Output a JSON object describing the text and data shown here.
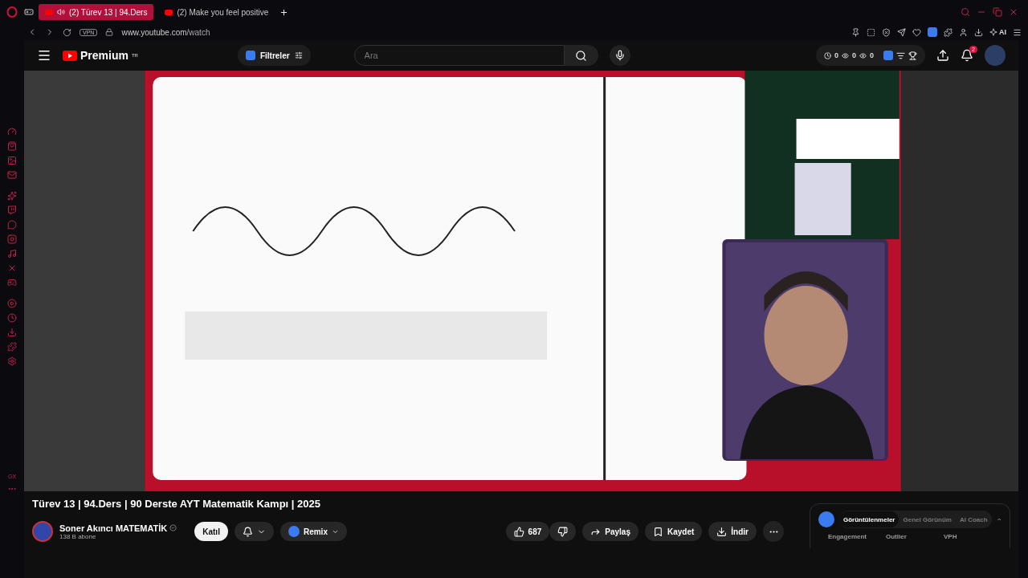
{
  "browser": {
    "tabs": [
      {
        "label": "(2) Türev 13 | 94.Ders",
        "selected": true,
        "audio": true
      },
      {
        "label": "(2) Make you feel positive",
        "selected": false,
        "audio": false
      }
    ],
    "vpn": "VPN",
    "url_host": "www.youtube.com",
    "url_path": "/watch",
    "ai_label": "AI"
  },
  "sidebar": {
    "bottom_label": "GX"
  },
  "header": {
    "logo": "Premium",
    "region": "TR",
    "filter": "Filtreler",
    "search": {
      "placeholder": "Ara"
    },
    "stats": [
      "0",
      "0",
      "0"
    ],
    "notifications": "2"
  },
  "title": "Türev 13 | 94.Ders | 90 Derste AYT Matematik Kampı | 2025",
  "channel": {
    "name": "Soner Akıncı MATEMATİK",
    "verified": true,
    "subscribers": "138 B abone"
  },
  "actions": {
    "join": "Katıl",
    "remix": "Remix",
    "likes": "687",
    "share": "Paylaş",
    "save": "Kaydet",
    "download": "İndir"
  },
  "panel": {
    "tabs": [
      {
        "label": "Görüntülenmeler",
        "selected": true
      },
      {
        "label": "Genel Görünüm",
        "selected": false
      },
      {
        "label": "AI Coach",
        "selected": false
      }
    ],
    "columns": [
      "Engagement",
      "Outlier",
      "VPH"
    ]
  }
}
